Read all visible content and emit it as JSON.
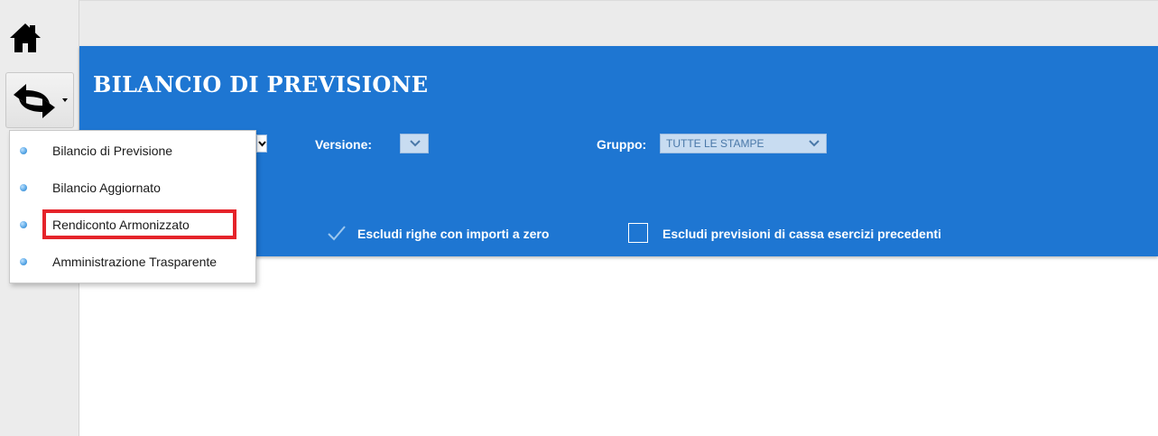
{
  "header": {
    "title": "BILANCIO DI PREVISIONE"
  },
  "filters": {
    "versione_label": "Versione:",
    "versione_value": "",
    "gruppo_label": "Gruppo:",
    "gruppo_value": "TUTTE LE STAMPE"
  },
  "options": {
    "escludi_zero_label": "Escludi righe con importi a zero",
    "escludi_zero_checked": true,
    "escludi_cassa_label": "Escludi previsioni di cassa esercizi precedenti",
    "escludi_cassa_checked": false
  },
  "nav": {
    "home_icon": "home-icon",
    "switch_icon": "switch-arrows-icon"
  },
  "menu": {
    "items": [
      {
        "label": "Bilancio di Previsione"
      },
      {
        "label": "Bilancio Aggiornato"
      },
      {
        "label": "Rendiconto Armonizzato",
        "highlighted": true
      },
      {
        "label": "Amministrazione Trasparente"
      }
    ]
  },
  "colors": {
    "panel_blue": "#1e76d2",
    "highlight_red": "#e5232a"
  }
}
